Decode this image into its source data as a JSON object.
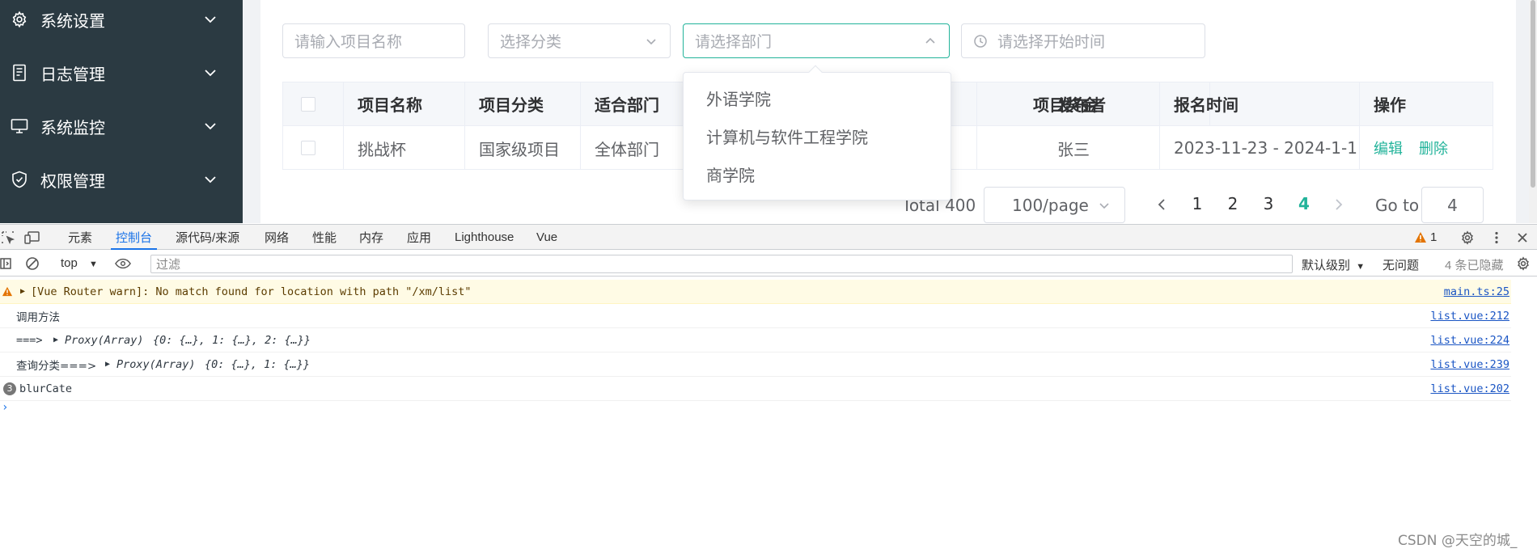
{
  "sidebar": {
    "items": [
      {
        "label": "系统设置",
        "icon": "gear-icon"
      },
      {
        "label": "日志管理",
        "icon": "document-icon"
      },
      {
        "label": "系统监控",
        "icon": "monitor-icon"
      },
      {
        "label": "权限管理",
        "icon": "shield-icon"
      }
    ]
  },
  "filters": {
    "project_name_placeholder": "请输入项目名称",
    "category_placeholder": "选择分类",
    "department_placeholder": "请选择部门",
    "start_time_placeholder": "请选择开始时间"
  },
  "department_dropdown": {
    "options": [
      "外语学院",
      "计算机与软件工程学院",
      "商学院"
    ]
  },
  "table": {
    "columns": [
      "项目名称",
      "项目分类",
      "适合部门",
      "项目奖金",
      "发布者",
      "报名时间",
      "操作"
    ],
    "columns_visible_text": {
      "bonus_partial": "项目奖金"
    },
    "rows": [
      {
        "name": "挑战杯",
        "category": "国家级项目",
        "department": "全体部门",
        "bonus": "",
        "publisher": "张三",
        "period": "2023-11-23 - 2024-1-1",
        "edit": "编辑",
        "delete": "删除"
      }
    ]
  },
  "pagination": {
    "total": "Total 400",
    "page_size": "100/page",
    "pages": [
      "1",
      "2",
      "3",
      "4"
    ],
    "current": "4",
    "goto_label": "Go to",
    "goto_value": "4"
  },
  "devtools": {
    "tabs": [
      "元素",
      "控制台",
      "源代码/来源",
      "网络",
      "性能",
      "内存",
      "应用",
      "Lighthouse",
      "Vue"
    ],
    "active_tab": "控制台",
    "warning_count": "1",
    "context": "top",
    "filter_placeholder": "过滤",
    "level": "默认级别",
    "issues": "无问题",
    "hidden": "4 条已隐藏",
    "messages": [
      {
        "type": "warn",
        "text": "[Vue Router warn]: No match found for location with path \"/xm/list\"",
        "source": "main.ts:25"
      },
      {
        "type": "log",
        "text": "调用方法",
        "source": "list.vue:212"
      },
      {
        "type": "log",
        "prefix": "===> ",
        "proxy": "Proxy(Array) ",
        "object": "{0: {…}, 1: {…}, 2: {…}}",
        "source": "list.vue:224"
      },
      {
        "type": "log",
        "prefix": "查询分类===> ",
        "proxy": "Proxy(Array) ",
        "object": "{0: {…}, 1: {…}}",
        "source": "list.vue:239"
      },
      {
        "type": "log",
        "count": "3",
        "text": "blurCate",
        "source": "list.vue:202"
      }
    ]
  },
  "watermark": "CSDN @天空的城_",
  "colors": {
    "sidebar": "#2b3a42",
    "accent": "#22b39a",
    "devtools_blue": "#1a73e8",
    "warn_bg": "#fffbe5"
  }
}
